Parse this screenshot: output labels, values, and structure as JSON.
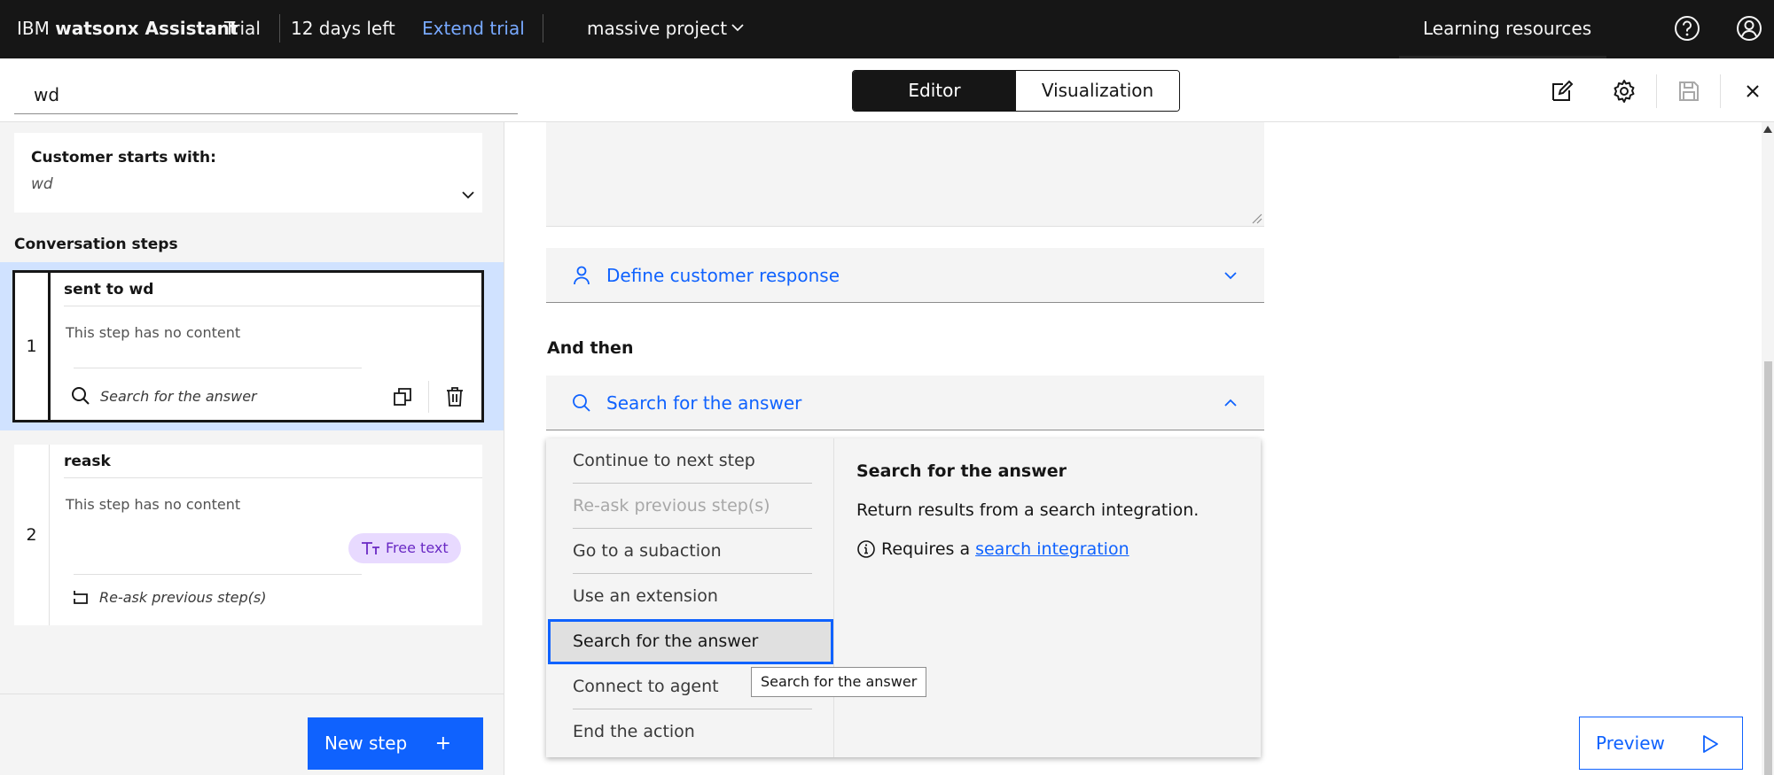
{
  "topbar": {
    "brand_prefix": "IBM",
    "brand_bold": "watsonx Assistant",
    "plan": "Trial",
    "days_left": "12 days left",
    "extend_trial": "Extend trial",
    "project": "massive project",
    "learning_resources": "Learning resources"
  },
  "toolbar": {
    "action_name": "wd",
    "editor_tab": "Editor",
    "visualization_tab": "Visualization"
  },
  "sidebar": {
    "starts_label": "Customer starts with:",
    "starts_value": "wd",
    "conversation_steps": "Conversation steps",
    "steps": [
      {
        "number": "1",
        "title": "sent to wd",
        "content": "This step has no content",
        "action": "Search for the answer"
      },
      {
        "number": "2",
        "title": "reask",
        "content": "This step has no content",
        "badge": "Free text",
        "action": "Re-ask previous step(s)"
      }
    ],
    "new_step": "New step",
    "new_step_plus": "+"
  },
  "editor": {
    "define_response": "Define customer response",
    "and_then": "And then",
    "and_then_selected": "Search for the answer",
    "options": [
      "Continue to next step",
      "Re-ask previous step(s)",
      "Go to a subaction",
      "Use an extension",
      "Search for the answer",
      "Connect to agent",
      "End the action"
    ],
    "detail_title": "Search for the answer",
    "detail_desc": "Return results from a search integration.",
    "detail_req_prefix": "Requires a",
    "detail_req_link": "search integration",
    "tooltip": "Search for the answer",
    "preview": "Preview"
  },
  "colors": {
    "accent": "#0f62fe",
    "topbar_bg": "#161616",
    "selected_step_bg": "#d0e2ff",
    "badge_bg": "#e8daff",
    "badge_text": "#6929c4"
  },
  "icons": [
    "chevron-down-icon",
    "help-icon",
    "user-avatar-icon",
    "edit-icon",
    "settings-icon",
    "save-icon",
    "close-icon",
    "search-icon",
    "copy-icon",
    "trash-icon",
    "free-text-icon",
    "reask-icon",
    "person-icon",
    "chevron-up-icon",
    "info-icon",
    "play-icon"
  ]
}
